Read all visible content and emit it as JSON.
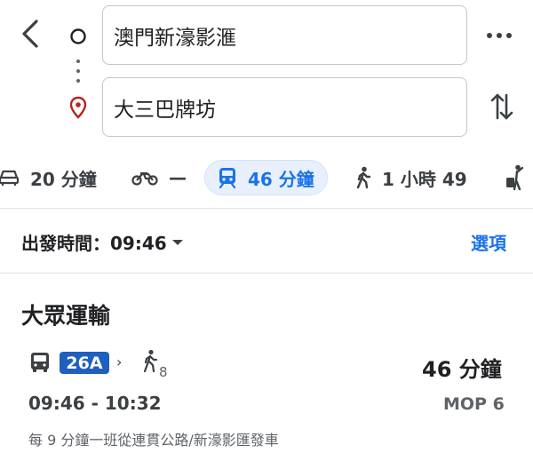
{
  "header": {
    "origin": "澳門新濠影滙",
    "destination": "大三巴牌坊"
  },
  "modes": {
    "driving": "20 分鐘",
    "motorcycle": "—",
    "transit": "46 分鐘",
    "walking": "1 小時 49"
  },
  "depart": {
    "label": "出發時間：09:46",
    "options": "選項"
  },
  "section": {
    "title": "大眾運輸"
  },
  "route": {
    "bus_number": "26A",
    "chevron": "›",
    "walk_minutes": "8",
    "duration": "46 分鐘",
    "times": "09:46 - 10:32",
    "fare": "MOP 6",
    "frequency": "每 9 分鐘一班從連貫公路/新濠影匯發車"
  },
  "colors": {
    "accent": "#1a73e8",
    "transit_bg": "#e8f0fe",
    "route_badge": "#1f5fbf",
    "pin_red": "#b3261e"
  },
  "icons": [
    "back-arrow-icon",
    "origin-circle-icon",
    "destination-pin-icon",
    "more-icon",
    "swap-icon",
    "car-icon",
    "motorcycle-icon",
    "train-icon",
    "walk-icon",
    "ride-hail-icon",
    "bus-icon"
  ]
}
